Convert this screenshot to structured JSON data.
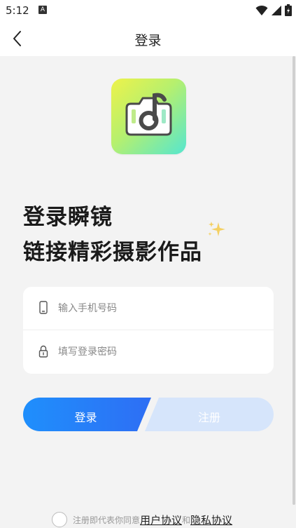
{
  "status_bar": {
    "time": "5:12",
    "notification_badge": "A",
    "icons": [
      "wifi-icon",
      "signal-icon",
      "battery-icon"
    ]
  },
  "nav": {
    "title": "登录",
    "back_icon": "chevron-left-icon"
  },
  "logo": {
    "icon": "camera-music-note-icon"
  },
  "headline": {
    "line1": "登录瞬镜",
    "line2": "链接精彩摄影作品",
    "decoration_icon": "sparkle-icon"
  },
  "form": {
    "phone": {
      "placeholder": "输入手机号码",
      "value": "",
      "icon": "phone-icon"
    },
    "password": {
      "placeholder": "填写登录密码",
      "value": "",
      "icon": "lock-icon"
    }
  },
  "buttons": {
    "login_label": "登录",
    "register_label": "注册"
  },
  "agreement": {
    "prefix": "注册即代表你同意",
    "user_agreement": "用户协议",
    "and": "和",
    "privacy_policy": "隐私协议",
    "checked": false
  },
  "colors": {
    "login_gradient_start": "#1e90ff",
    "login_gradient_end": "#2f6ff5",
    "register_bg": "#d7e6fb",
    "logo_gradient": [
      "#eef24a",
      "#b6f06e",
      "#55e6cf"
    ]
  }
}
